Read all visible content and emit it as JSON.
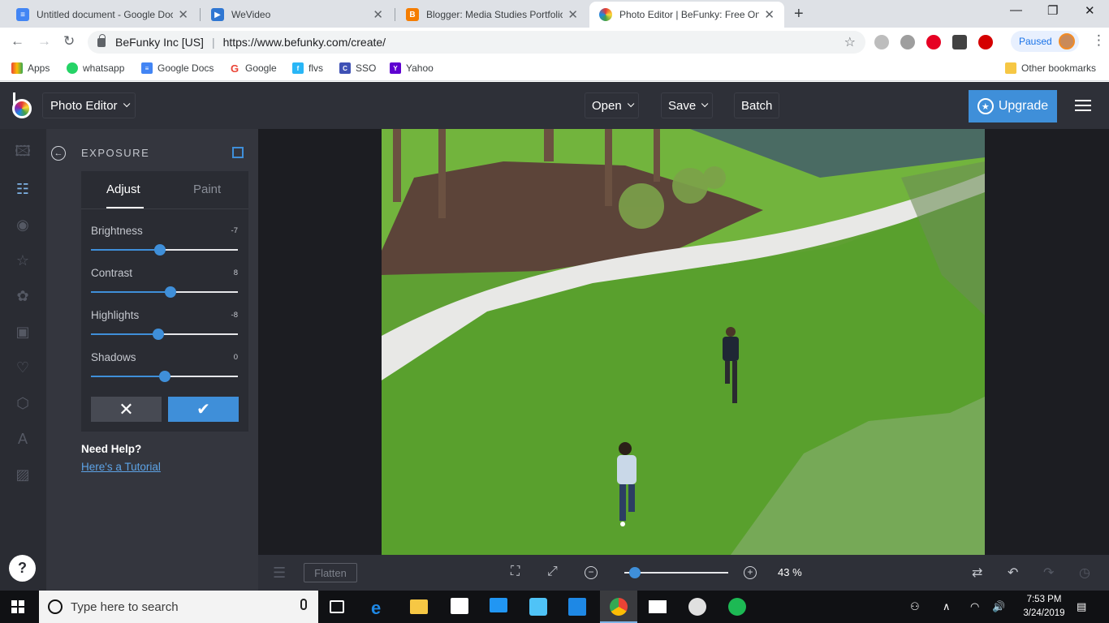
{
  "tabs": [
    {
      "title": "Untitled document - Google Docs",
      "favicon_color": "#4285f4",
      "active": false
    },
    {
      "title": "WeVideo",
      "favicon_color": "#2f76d2",
      "active": false
    },
    {
      "title": "Blogger: Media Studies Portfolio",
      "favicon_color": "#f57d00",
      "active": false
    },
    {
      "title": "Photo Editor | BeFunky: Free Online",
      "favicon_color": "#e53935",
      "active": true
    }
  ],
  "omnibox": {
    "org": "BeFunky Inc [US]",
    "url": "https://www.befunky.com/create/"
  },
  "profile": {
    "status": "Paused"
  },
  "bookmarks": [
    {
      "label": "Apps",
      "color": "#ea4335"
    },
    {
      "label": "whatsapp",
      "color": "#25d366"
    },
    {
      "label": "Google Docs",
      "color": "#4285f4"
    },
    {
      "label": "Google",
      "color": "#ea4335"
    },
    {
      "label": "flvs",
      "color": "#29b6f6"
    },
    {
      "label": "SSO",
      "color": "#3f51b5"
    },
    {
      "label": "Yahoo",
      "color": "#5f01d1"
    }
  ],
  "other_bookmarks": "Other bookmarks",
  "app": {
    "name": "Photo Editor",
    "menu": {
      "open": "Open",
      "save": "Save",
      "batch": "Batch"
    },
    "upgrade": "Upgrade"
  },
  "panel": {
    "title": "EXPOSURE",
    "tab_adjust": "Adjust",
    "tab_paint": "Paint",
    "sliders": [
      {
        "label": "Brightness",
        "value": "-7",
        "fraction": 0.47
      },
      {
        "label": "Contrast",
        "value": "8",
        "fraction": 0.54
      },
      {
        "label": "Highlights",
        "value": "-8",
        "fraction": 0.46
      },
      {
        "label": "Shadows",
        "value": "0",
        "fraction": 0.5
      }
    ],
    "help_title": "Need Help?",
    "help_link": "Here's a Tutorial"
  },
  "bottom": {
    "flatten": "Flatten",
    "zoom": "43 %",
    "zoom_fraction": 0.1
  },
  "taskbar": {
    "search_placeholder": "Type here to search",
    "time": "7:53 PM",
    "date": "3/24/2019"
  }
}
